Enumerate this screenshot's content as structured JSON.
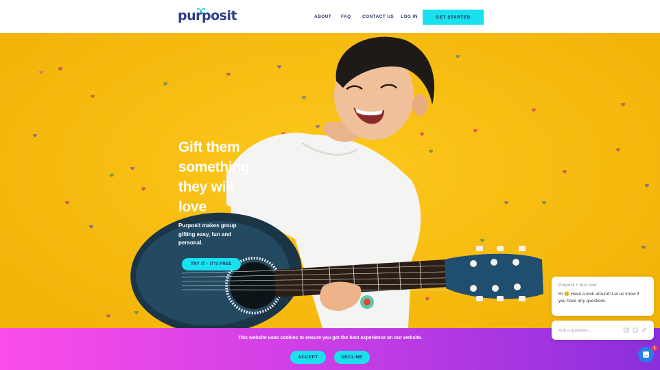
{
  "header": {
    "logo_text": "purposit",
    "nav": [
      {
        "label": "ABOUT"
      },
      {
        "label": "FAQ"
      },
      {
        "label": "CONTACT US"
      },
      {
        "label": "LOG IN"
      }
    ],
    "cta_label": "GET STARTED"
  },
  "hero": {
    "headline_lines": [
      "Gift them",
      "something",
      "they will",
      "love"
    ],
    "subtext": "Purposit makes group gifting easy, fun and personal.",
    "cta_label": "TRY IT - IT'S FREE"
  },
  "cookie": {
    "text": "This website uses cookies to ensure you get the best experience on our website.",
    "accept_label": "ACCEPT",
    "decline_label": "DECLINE"
  },
  "chat": {
    "meta": "Purposit • Just now",
    "message": "Hi 😊  Have a look around! Let us know if you have any questions.",
    "input_placeholder": "Ask a question...",
    "badge_count": "1",
    "tool_icons": [
      "gif-icon",
      "emoji-icon",
      "attachment-icon"
    ]
  },
  "colors": {
    "brand_navy": "#2d3c8c",
    "cta_cyan": "#19e1ee",
    "hero_yellow": "#f6bd0d",
    "cookie_gradient_start": "#fb4de8",
    "cookie_gradient_end": "#8a2fdc",
    "chat_blue": "#2a7ce6"
  }
}
